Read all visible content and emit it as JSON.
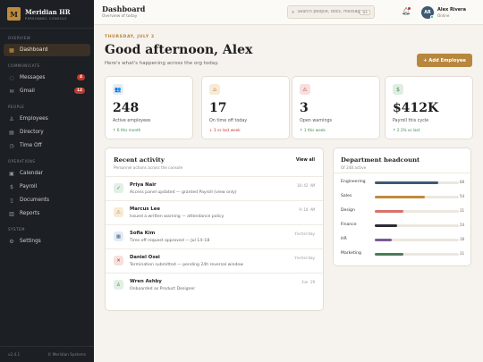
{
  "brand": {
    "name": "Meridian HR",
    "subtitle": "PERSONNEL CONSOLE",
    "logo_letter": "M"
  },
  "sidebar": {
    "sections": [
      {
        "title": "OVERVIEW",
        "items": [
          {
            "label": "Dashboard",
            "icon": "grid-icon",
            "active": true
          }
        ]
      },
      {
        "title": "COMMUNICATE",
        "items": [
          {
            "label": "Messages",
            "icon": "chat-icon",
            "badge": "4"
          },
          {
            "label": "Gmail",
            "icon": "mail-icon",
            "badge": "12"
          }
        ]
      },
      {
        "title": "PEOPLE",
        "items": [
          {
            "label": "Employees",
            "icon": "users-icon"
          },
          {
            "label": "Directory",
            "icon": "book-icon"
          },
          {
            "label": "Time Off",
            "icon": "clock-icon"
          }
        ]
      },
      {
        "title": "OPERATIONS",
        "items": [
          {
            "label": "Calendar",
            "icon": "calendar-icon"
          },
          {
            "label": "Payroll",
            "icon": "dollar-icon"
          },
          {
            "label": "Documents",
            "icon": "document-icon"
          },
          {
            "label": "Reports",
            "icon": "chart-icon"
          }
        ]
      },
      {
        "title": "SYSTEM",
        "items": [
          {
            "label": "Settings",
            "icon": "gear-icon"
          }
        ]
      }
    ],
    "version": "v2.4.1",
    "footer": "© Meridian Systems"
  },
  "topbar": {
    "title": "Dashboard",
    "subtitle": "Overview of today",
    "search_placeholder": "Search people, docs, messages",
    "search_shortcut": "⌘K",
    "user": {
      "initials": "AR",
      "name": "Alex Rivera",
      "status": "Online"
    }
  },
  "main": {
    "date": "THURSDAY, JULY 2",
    "greeting": "Good afternoon, Alex",
    "subtitle": "Here's what's happening across the org today.",
    "add_button": "+ Add Employee"
  },
  "stats": [
    {
      "icon": "users-icon",
      "icon_glyph": "👥",
      "icon_bg": "#e3ebf3",
      "icon_color": "#4a6b8a",
      "value": "248",
      "label": "Active employees",
      "delta": "↑ 6 this month",
      "trend": "up"
    },
    {
      "icon": "home-icon",
      "icon_glyph": "⌂",
      "icon_bg": "#f7ead6",
      "icon_color": "#b8873e",
      "value": "17",
      "label": "On time off today",
      "delta": "↓ 3 vs last week",
      "trend": "down"
    },
    {
      "icon": "warning-icon",
      "icon_glyph": "⚠",
      "icon_bg": "#f6e0de",
      "icon_color": "#c0392b",
      "value": "3",
      "label": "Open warnings",
      "delta": "↑ 1 this week",
      "trend": "up"
    },
    {
      "icon": "dollar-icon",
      "icon_glyph": "$",
      "icon_bg": "#e0ede3",
      "icon_color": "#3c8a4f",
      "value": "$412K",
      "label": "Payroll this cycle",
      "delta": "↑ 2.1% vs last",
      "trend": "up"
    }
  ],
  "activity": {
    "title": "Recent activity",
    "subtitle": "Personnel actions across the console",
    "view_all": "View all",
    "items": [
      {
        "icon": "check-icon",
        "glyph": "✓",
        "bg": "#e2efe5",
        "color": "#3c8a4f",
        "name": "Priya Nair",
        "desc": "Access panel updated — granted Payroll (view only)",
        "time": "10:42 AM"
      },
      {
        "icon": "warning-icon",
        "glyph": "⚠",
        "bg": "#f7ead6",
        "color": "#b8873e",
        "name": "Marcus Lee",
        "desc": "Issued a written warning — attendance policy",
        "time": "9:18 AM"
      },
      {
        "icon": "calendar-icon",
        "glyph": "▦",
        "bg": "#e3ebf3",
        "color": "#4a6b8a",
        "name": "Sofia Kim",
        "desc": "Time off request approved — Jul 14–18",
        "time": "Yesterday"
      },
      {
        "icon": "close-icon",
        "glyph": "✕",
        "bg": "#f6e0de",
        "color": "#c0392b",
        "name": "Daniel Osei",
        "desc": "Termination submitted — pending 24h reversal window",
        "time": "Yesterday"
      },
      {
        "icon": "person-icon",
        "glyph": "♙",
        "bg": "#e2efe5",
        "color": "#3c8a4f",
        "name": "Wren Ashby",
        "desc": "Onboarded as Product Designer",
        "time": "Jun 29"
      }
    ]
  },
  "headcount": {
    "title": "Department headcount",
    "subtitle": "Of 248 active",
    "rows": [
      {
        "label": "Engineering",
        "value": 68,
        "color": "#3d5a73"
      },
      {
        "label": "Sales",
        "value": 54,
        "color": "#c08a3e"
      },
      {
        "label": "Design",
        "value": 31,
        "color": "#d9706a"
      },
      {
        "label": "Finance",
        "value": 24,
        "color": "#2b2d33"
      },
      {
        "label": "HR",
        "value": 18,
        "color": "#7a5a9a"
      },
      {
        "label": "Marketing",
        "value": 31,
        "color": "#4a7d5a"
      }
    ],
    "scale_max": 90
  }
}
